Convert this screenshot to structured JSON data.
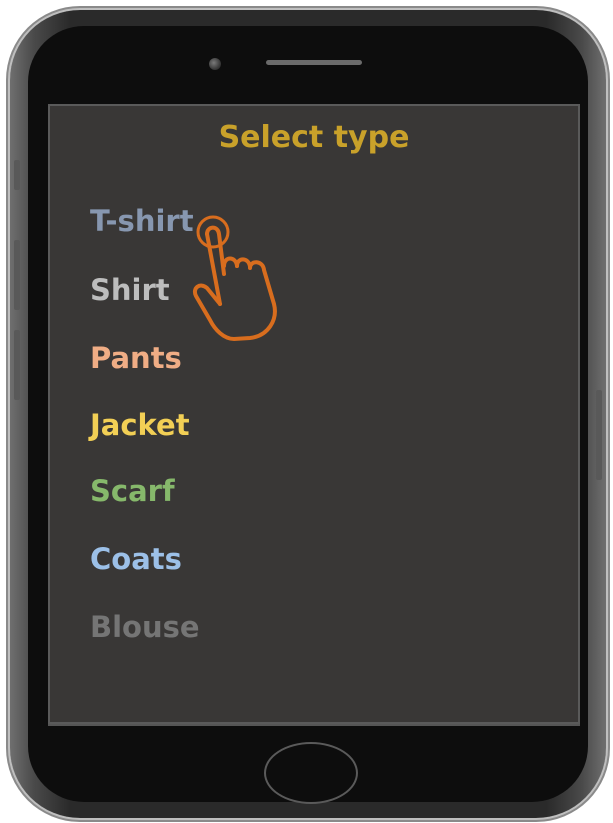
{
  "screen": {
    "title": "Select type",
    "title_color": "#c9a12a",
    "background": "#393736"
  },
  "options": [
    {
      "label": "T-shirt",
      "color": "#8797b0"
    },
    {
      "label": "Shirt",
      "color": "#bdbdbd"
    },
    {
      "label": "Pants",
      "color": "#f0ad85"
    },
    {
      "label": "Jacket",
      "color": "#f2cf55"
    },
    {
      "label": "Scarf",
      "color": "#86b86b"
    },
    {
      "label": "Coats",
      "color": "#9cc0e8"
    },
    {
      "label": "Blouse",
      "color": "#757575"
    }
  ],
  "icons": {
    "pointer": "hand-pointer-icon",
    "pointer_color": "#d86d1e"
  }
}
